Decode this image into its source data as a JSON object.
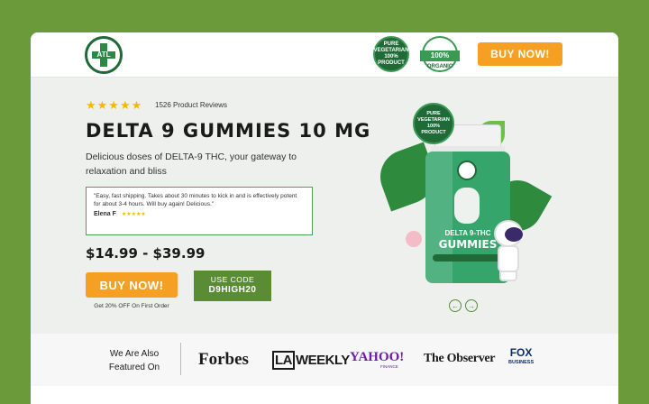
{
  "header": {
    "logo_text": "ATL",
    "badge1_text": "PURE VEGETARIAN 100% PRODUCT",
    "badge2_text": "100%",
    "badge2_sub": "ORGANIC",
    "buy_label": "BUY NOW!"
  },
  "hero": {
    "stars": "★★★★★",
    "reviews": "1526 Product Reviews",
    "title": "DELTA 9 GUMMIES 10 MG",
    "subtitle": "Delicious doses of DELTA-9 THC, your gateway to relaxation and bliss",
    "testimonial": {
      "quote": "\"Easy, fast shipping. Takes about 30 minutes to kick in and is effectively potent for about 3-4 hours. Will buy again! Delicious.\"",
      "author": "Elena F",
      "stars": "★★★★★"
    },
    "price": "$14.99 - $39.99",
    "buy_label": "BUY NOW!",
    "discount": "Get 20% OFF On First Order",
    "code_label": "USE CODE",
    "code_value": "D9HIGH20"
  },
  "product": {
    "badge_text": "PURE VEGETARIAN 100% PRODUCT",
    "label_title": "DELTA 9-THC",
    "label_big": "GUMMIES"
  },
  "carousel": {
    "prev": "←",
    "next": "→"
  },
  "featured": {
    "label": "We Are Also Featured On",
    "brands": [
      "Forbes",
      "WEEKLY",
      "YAHOO!",
      "The Observer",
      "FOX"
    ],
    "la_prefix": "LA",
    "yahoo_sub": "FINANCE",
    "fox_sub": "BUSINESS"
  },
  "colors": {
    "page_bg": "#6b9a3a",
    "accent_orange": "#f5a023",
    "brand_green": "#1f6a37",
    "code_green": "#5a8c36"
  }
}
